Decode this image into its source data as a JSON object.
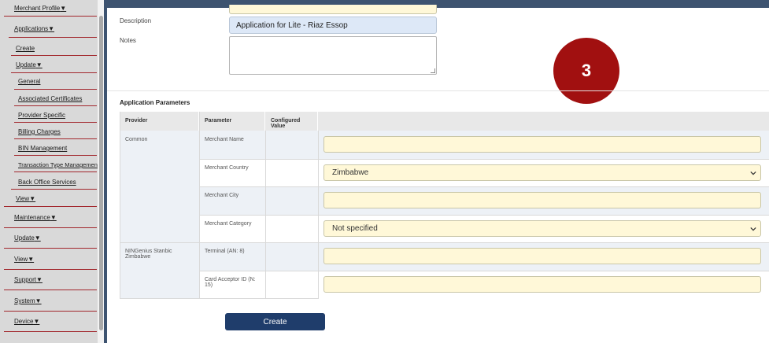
{
  "sidebar": {
    "items": [
      {
        "label": "Merchant Profile",
        "caret": "▼"
      },
      {
        "label": "Applications",
        "caret": "▼"
      },
      {
        "label": "Create",
        "caret": ""
      },
      {
        "label": "Update",
        "caret": "▼"
      },
      {
        "label": "General",
        "caret": ""
      },
      {
        "label": "Associated Certificates",
        "caret": ""
      },
      {
        "label": "Provider Specific",
        "caret": ""
      },
      {
        "label": "Billing Charges",
        "caret": ""
      },
      {
        "label": "BIN Management",
        "caret": ""
      },
      {
        "label": "Transaction Type Management",
        "caret": ""
      },
      {
        "label": "Back Office Services",
        "caret": ""
      },
      {
        "label": "View",
        "caret": "▼"
      },
      {
        "label": "Maintenance",
        "caret": "▼"
      },
      {
        "label": "Update",
        "caret": "▼"
      },
      {
        "label": "View",
        "caret": "▼"
      },
      {
        "label": "Support",
        "caret": "▼"
      },
      {
        "label": "System",
        "caret": "▼"
      },
      {
        "label": "Device",
        "caret": "▼"
      }
    ]
  },
  "form": {
    "description_label": "Description",
    "description_value": "Application for Lite - Riaz Essop",
    "notes_label": "Notes",
    "notes_value": ""
  },
  "step_badge": "3",
  "parameters": {
    "title": "Application Parameters",
    "headers": [
      "Provider",
      "Parameter",
      "Configured Value"
    ],
    "providers": [
      "Common",
      "NINGenius Stanbic Zimbabwe"
    ],
    "rows": [
      {
        "parameter": "Merchant Name",
        "value": "",
        "type": "text"
      },
      {
        "parameter": "Merchant Country",
        "value": "Zimbabwe",
        "type": "select"
      },
      {
        "parameter": "Merchant City",
        "value": "",
        "type": "text"
      },
      {
        "parameter": "Merchant Category",
        "value": "Not specified",
        "type": "select"
      },
      {
        "parameter": "Terminal (AN: 8)",
        "value": "",
        "type": "text"
      },
      {
        "parameter": "Card Acceptor ID (N: 15)",
        "value": "",
        "type": "text"
      }
    ]
  },
  "actions": {
    "create_label": "Create"
  },
  "colors": {
    "primary": "#1f3d6b",
    "badge": "#a11010",
    "separator": "#a2272d",
    "input_bg": "#fff8d8"
  }
}
